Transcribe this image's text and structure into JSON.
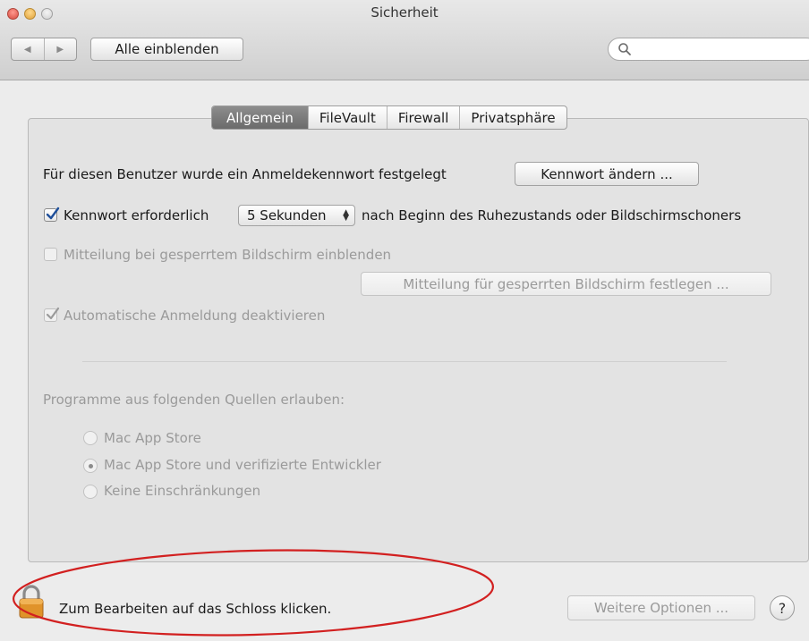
{
  "window": {
    "title": "Sicherheit"
  },
  "toolbar": {
    "back_icon": "◀",
    "forward_icon": "▶",
    "show_all_label": "Alle einblenden",
    "search_placeholder": ""
  },
  "tabs": [
    {
      "label": "Allgemein",
      "active": true
    },
    {
      "label": "FileVault",
      "active": false
    },
    {
      "label": "Firewall",
      "active": false
    },
    {
      "label": "Privatsphäre",
      "active": false
    }
  ],
  "general": {
    "password_set_text": "Für diesen Benutzer wurde ein Anmeldekennwort festgelegt",
    "change_password_button": "Kennwort ändern ...",
    "require_password_label": "Kennwort erforderlich",
    "require_password_checked": true,
    "delay_select_value": "5 Sekunden",
    "after_sleep_text": "nach Beginn des Ruhezustands oder Bildschirmschoners",
    "show_message_label": "Mitteilung bei gesperrtem Bildschirm einblenden",
    "show_message_checked": false,
    "set_message_button": "Mitteilung für gesperrten Bildschirm festlegen ...",
    "disable_autologin_label": "Automatische Anmeldung deaktivieren",
    "disable_autologin_checked": true
  },
  "sources": {
    "heading": "Programme aus folgenden Quellen erlauben:",
    "options": [
      {
        "label": "Mac App Store",
        "selected": false
      },
      {
        "label": "Mac App Store und verifizierte Entwickler",
        "selected": true
      },
      {
        "label": "Keine Einschränkungen",
        "selected": false
      }
    ]
  },
  "footer": {
    "lock_text": "Zum Bearbeiten auf das Schloss klicken.",
    "more_options_button": "Weitere Optionen ...",
    "help_label": "?"
  },
  "colors": {
    "annotation_ellipse": "#d22020",
    "active_tab": "#7a7a7a",
    "lock_body": "#e0932a"
  }
}
